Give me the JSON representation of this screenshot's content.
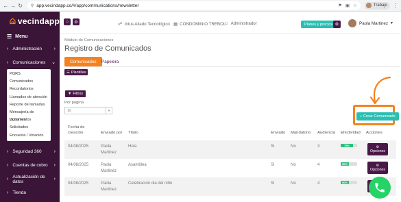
{
  "browser": {
    "url": "app.vecindapp.co/#/app/communications/newsletter",
    "profile": "Trabajo",
    "colors": {
      "chrome_bg": "#f1f3f4"
    }
  },
  "sidebar": {
    "brand": "vecindapp",
    "menu_label": "Menu",
    "items_top": [
      {
        "label": "Administración",
        "icon": "chevron-right-icon"
      },
      {
        "label": "Comunicaciones",
        "icon": "chevron-right-icon"
      }
    ],
    "submenu": [
      "PQRS",
      "Comunicados",
      "Recordatorios",
      "Llamados de atención",
      "Reporte de llamadas",
      "Mensajería de vigilantes",
      "Documentos",
      "Solicitudes",
      "Encuesta / Votación"
    ],
    "items_bottom": [
      {
        "label": "Seguridad 360"
      },
      {
        "label": "Cuentas de cobro"
      },
      {
        "label": "Actualización de datos"
      },
      {
        "label": "Tienda"
      }
    ],
    "colors": {
      "bg": "#3a1538"
    }
  },
  "topbar": {
    "intus": "Intus Aliado Tecnológico",
    "condominio": "CONDOMINIO TREBOL",
    "role": "Administrador",
    "planes_label": "Planes y precios",
    "user_name": "Paola Martinez"
  },
  "page": {
    "breadcrumb": "Módulo de Comunicaciones",
    "title": "Registro de Comunicados",
    "tabs": [
      "Comunicados",
      "Papelera"
    ],
    "plantillas_label": "Plantillas",
    "filtros_label": "Filtros",
    "per_page_label": "Por página",
    "per_page_value": "10",
    "crear_label": "+ Crear Comunicado",
    "accent": "#f58220",
    "primary": "#4a1848",
    "teal": "#2bbfb3"
  },
  "table": {
    "headers": {
      "fecha": "Fecha de creación",
      "enviado_por": "Enviado por",
      "titulo": "Título",
      "enviado": "Enviado",
      "mandatorio": "Mandatorio",
      "audiencia": "Audiencia",
      "efectividad": "Efectividad",
      "acciones": "Acciones"
    },
    "options_label": "Opciones",
    "rows": [
      {
        "fecha": "04/08/2025",
        "sender1": "Paola",
        "sender2": "Martinez",
        "titulo": "Hola",
        "enviado": "Si",
        "mandatorio": "No",
        "audiencia": "3",
        "efectividad": "75%",
        "eff_value": 75
      },
      {
        "fecha": "04/08/2025",
        "sender1": "Paola",
        "sender2": "Martinez",
        "titulo": "Asamblea",
        "enviado": "Si",
        "mandatorio": "No",
        "audiencia": "4",
        "efectividad": "50%",
        "eff_value": 50
      },
      {
        "fecha": "04/08/2025",
        "sender1": "Paola",
        "sender2": "Martinez",
        "titulo": "Celebración dia del niño",
        "enviado": "Si",
        "mandatorio": "No",
        "audiencia": "4",
        "efectividad": "50%",
        "eff_value": 50
      }
    ]
  }
}
